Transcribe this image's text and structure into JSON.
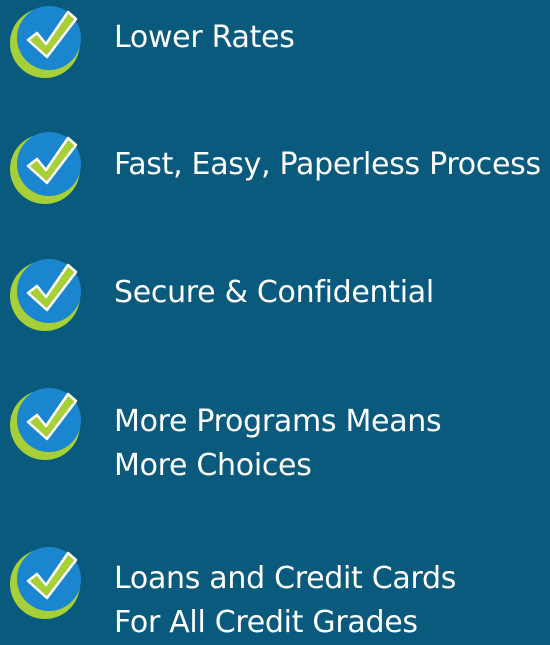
{
  "colors": {
    "background": "#0a5a7e",
    "badge_blue": "#1a86cf",
    "badge_green": "#a6cf38",
    "check_green": "#a6cf38",
    "text": "#ffffff"
  },
  "features": [
    {
      "icon": "checkmark-badge-icon",
      "lines": [
        "Lower Rates"
      ]
    },
    {
      "icon": "checkmark-badge-icon",
      "lines": [
        "Fast, Easy, Paperless Process"
      ]
    },
    {
      "icon": "checkmark-badge-icon",
      "lines": [
        "Secure & Confidential"
      ]
    },
    {
      "icon": "checkmark-badge-icon",
      "lines": [
        "More Programs Means",
        "More Choices"
      ]
    },
    {
      "icon": "checkmark-badge-icon",
      "lines": [
        "Loans and Credit Cards",
        "For All Credit Grades"
      ]
    }
  ]
}
